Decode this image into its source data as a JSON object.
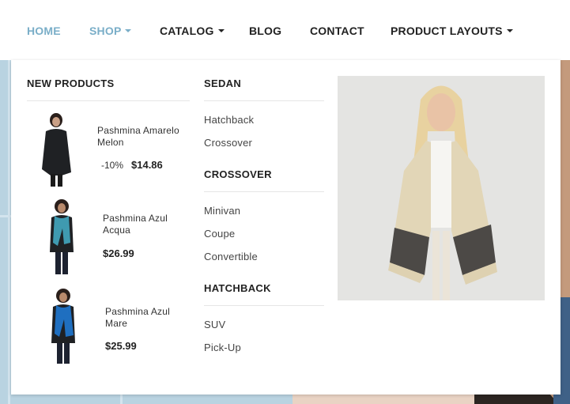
{
  "nav": {
    "home": "HOME",
    "shop": "SHOP",
    "catalog": "CATALOG",
    "blog": "BLOG",
    "contact": "CONTACT",
    "product_layouts": "PRODUCT LAYOUTS"
  },
  "colors": {
    "accent": "#7aaec8",
    "text": "#222222"
  },
  "new_products": {
    "heading": "NEW PRODUCTS",
    "items": [
      {
        "name": "Pashmina Amarelo Melon",
        "discount": "-10%",
        "price": "$14.86",
        "image": "woman-black-wrap"
      },
      {
        "name": "Pashmina Azul Acqua",
        "price": "$26.99",
        "image": "woman-teal-scarf"
      },
      {
        "name": "Pashmina Azul Mare",
        "price": "$25.99",
        "image": "woman-blue-scarf"
      }
    ]
  },
  "categories": [
    {
      "heading": "SEDAN",
      "links": [
        "Hatchback",
        "Crossover"
      ]
    },
    {
      "heading": "CROSSOVER",
      "links": [
        "Minivan",
        "Coupe",
        "Convertible"
      ]
    },
    {
      "heading": "HATCHBACK",
      "links": [
        "SUV",
        "Pick-Up"
      ]
    }
  ],
  "featured_image": "woman-cream-poncho"
}
